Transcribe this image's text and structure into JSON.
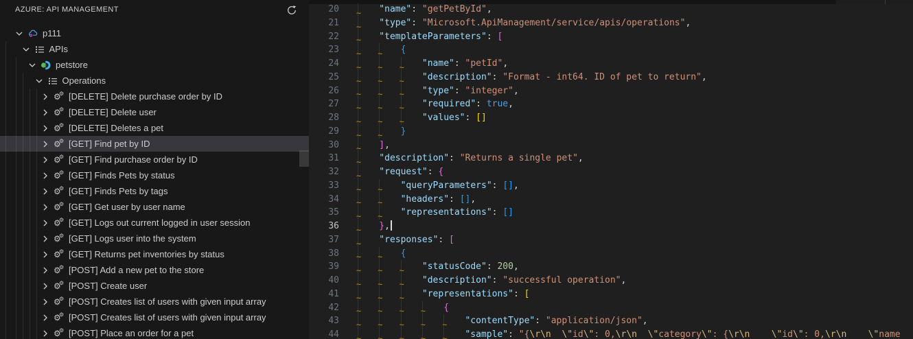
{
  "sidebar": {
    "title": "AZURE: API MANAGEMENT",
    "refresh_tooltip": "Refresh",
    "tree": [
      {
        "label": "p111",
        "level": 0,
        "icon": "azure-apim",
        "expanded": true,
        "selected": false
      },
      {
        "label": "APIs",
        "level": 1,
        "icon": "list",
        "expanded": true,
        "selected": false
      },
      {
        "label": "petstore",
        "level": 2,
        "icon": "api",
        "expanded": true,
        "selected": false
      },
      {
        "label": "Operations",
        "level": 3,
        "icon": "list",
        "expanded": true,
        "selected": false
      },
      {
        "label": "[DELETE] Delete purchase order by ID",
        "level": 4,
        "icon": "operation",
        "expanded": false,
        "selected": false
      },
      {
        "label": "[DELETE] Delete user",
        "level": 4,
        "icon": "operation",
        "expanded": false,
        "selected": false
      },
      {
        "label": "[DELETE] Deletes a pet",
        "level": 4,
        "icon": "operation",
        "expanded": false,
        "selected": false
      },
      {
        "label": "[GET] Find pet by ID",
        "level": 4,
        "icon": "operation",
        "expanded": false,
        "selected": true
      },
      {
        "label": "[GET] Find purchase order by ID",
        "level": 4,
        "icon": "operation",
        "expanded": false,
        "selected": false
      },
      {
        "label": "[GET] Finds Pets by status",
        "level": 4,
        "icon": "operation",
        "expanded": false,
        "selected": false
      },
      {
        "label": "[GET] Finds Pets by tags",
        "level": 4,
        "icon": "operation",
        "expanded": false,
        "selected": false
      },
      {
        "label": "[GET] Get user by user name",
        "level": 4,
        "icon": "operation",
        "expanded": false,
        "selected": false
      },
      {
        "label": "[GET] Logs out current logged in user session",
        "level": 4,
        "icon": "operation",
        "expanded": false,
        "selected": false
      },
      {
        "label": "[GET] Logs user into the system",
        "level": 4,
        "icon": "operation",
        "expanded": false,
        "selected": false
      },
      {
        "label": "[GET] Returns pet inventories by status",
        "level": 4,
        "icon": "operation",
        "expanded": false,
        "selected": false
      },
      {
        "label": "[POST] Add a new pet to the store",
        "level": 4,
        "icon": "operation",
        "expanded": false,
        "selected": false
      },
      {
        "label": "[POST] Create user",
        "level": 4,
        "icon": "operation",
        "expanded": false,
        "selected": false
      },
      {
        "label": "[POST] Creates list of users with given input array",
        "level": 4,
        "icon": "operation",
        "expanded": false,
        "selected": false
      },
      {
        "label": "[POST] Creates list of users with given input array",
        "level": 4,
        "icon": "operation",
        "expanded": false,
        "selected": false
      },
      {
        "label": "[POST] Place an order for a pet",
        "level": 4,
        "icon": "operation",
        "expanded": false,
        "selected": false
      }
    ]
  },
  "editor": {
    "language": "json",
    "active_line": 36,
    "first_line": 20,
    "lines": [
      {
        "n": 20,
        "tabs": 1,
        "tokens": [
          [
            "k",
            "\"name\""
          ],
          [
            "p",
            ": "
          ],
          [
            "s",
            "\"getPetById\""
          ],
          [
            "p",
            ","
          ]
        ]
      },
      {
        "n": 21,
        "tabs": 1,
        "tokens": [
          [
            "k",
            "\"type\""
          ],
          [
            "p",
            ": "
          ],
          [
            "s",
            "\"Microsoft.ApiManagement/service/apis/operations\""
          ],
          [
            "p",
            ","
          ]
        ]
      },
      {
        "n": 22,
        "tabs": 1,
        "tokens": [
          [
            "k",
            "\"templateParameters\""
          ],
          [
            "p",
            ": "
          ],
          [
            "m",
            "["
          ]
        ]
      },
      {
        "n": 23,
        "tabs": 2,
        "tokens": [
          [
            "u",
            "{"
          ]
        ]
      },
      {
        "n": 24,
        "tabs": 3,
        "tokens": [
          [
            "k",
            "\"name\""
          ],
          [
            "p",
            ": "
          ],
          [
            "s",
            "\"petId\""
          ],
          [
            "p",
            ","
          ]
        ]
      },
      {
        "n": 25,
        "tabs": 3,
        "tokens": [
          [
            "k",
            "\"description\""
          ],
          [
            "p",
            ": "
          ],
          [
            "s",
            "\"Format - int64. ID of pet to return\""
          ],
          [
            "p",
            ","
          ]
        ]
      },
      {
        "n": 26,
        "tabs": 3,
        "tokens": [
          [
            "k",
            "\"type\""
          ],
          [
            "p",
            ": "
          ],
          [
            "s",
            "\"integer\""
          ],
          [
            "p",
            ","
          ]
        ]
      },
      {
        "n": 27,
        "tabs": 3,
        "tokens": [
          [
            "k",
            "\"required\""
          ],
          [
            "p",
            ": "
          ],
          [
            "b",
            "true"
          ],
          [
            "p",
            ","
          ]
        ]
      },
      {
        "n": 28,
        "tabs": 3,
        "tokens": [
          [
            "k",
            "\"values\""
          ],
          [
            "p",
            ": "
          ],
          [
            "g",
            "[]"
          ]
        ]
      },
      {
        "n": 29,
        "tabs": 2,
        "tokens": [
          [
            "u",
            "}"
          ]
        ]
      },
      {
        "n": 30,
        "tabs": 1,
        "tokens": [
          [
            "m",
            "]"
          ],
          [
            "p",
            ","
          ]
        ]
      },
      {
        "n": 31,
        "tabs": 1,
        "tokens": [
          [
            "k",
            "\"description\""
          ],
          [
            "p",
            ": "
          ],
          [
            "s",
            "\"Returns a single pet\""
          ],
          [
            "p",
            ","
          ]
        ]
      },
      {
        "n": 32,
        "tabs": 1,
        "tokens": [
          [
            "k",
            "\"request\""
          ],
          [
            "p",
            ": "
          ],
          [
            "m",
            "{"
          ]
        ]
      },
      {
        "n": 33,
        "tabs": 2,
        "tokens": [
          [
            "k",
            "\"queryParameters\""
          ],
          [
            "p",
            ": "
          ],
          [
            "u",
            "[]"
          ],
          [
            "p",
            ","
          ]
        ]
      },
      {
        "n": 34,
        "tabs": 2,
        "tokens": [
          [
            "k",
            "\"headers\""
          ],
          [
            "p",
            ": "
          ],
          [
            "u",
            "[]"
          ],
          [
            "p",
            ","
          ]
        ]
      },
      {
        "n": 35,
        "tabs": 2,
        "tokens": [
          [
            "k",
            "\"representations\""
          ],
          [
            "p",
            ": "
          ],
          [
            "u",
            "[]"
          ]
        ]
      },
      {
        "n": 36,
        "tabs": 1,
        "tokens": [
          [
            "m",
            "}"
          ],
          [
            "p",
            ","
          ],
          [
            "cur",
            ""
          ]
        ]
      },
      {
        "n": 37,
        "tabs": 1,
        "tokens": [
          [
            "k",
            "\"responses\""
          ],
          [
            "p",
            ": "
          ],
          [
            "m",
            "["
          ]
        ]
      },
      {
        "n": 38,
        "tabs": 2,
        "tokens": [
          [
            "u",
            "{"
          ]
        ]
      },
      {
        "n": 39,
        "tabs": 3,
        "tokens": [
          [
            "k",
            "\"statusCode\""
          ],
          [
            "p",
            ": "
          ],
          [
            "n",
            "200"
          ],
          [
            "p",
            ","
          ]
        ]
      },
      {
        "n": 40,
        "tabs": 3,
        "tokens": [
          [
            "k",
            "\"description\""
          ],
          [
            "p",
            ": "
          ],
          [
            "s",
            "\"successful operation\""
          ],
          [
            "p",
            ","
          ]
        ]
      },
      {
        "n": 41,
        "tabs": 3,
        "tokens": [
          [
            "k",
            "\"representations\""
          ],
          [
            "p",
            ": "
          ],
          [
            "g",
            "["
          ]
        ]
      },
      {
        "n": 42,
        "tabs": 4,
        "tokens": [
          [
            "m",
            "{"
          ]
        ]
      },
      {
        "n": 43,
        "tabs": 5,
        "tokens": [
          [
            "k",
            "\"contentType\""
          ],
          [
            "p",
            ": "
          ],
          [
            "s",
            "\"application/json\""
          ],
          [
            "p",
            ","
          ]
        ]
      },
      {
        "n": 44,
        "tabs": 5,
        "tokens": [
          [
            "k",
            "\"sample\""
          ],
          [
            "p",
            ": "
          ],
          [
            "s",
            "\"{"
          ],
          [
            "e",
            "\\r\\n"
          ],
          [
            "s",
            "  "
          ],
          [
            "e",
            "\\\""
          ],
          [
            "s",
            "id"
          ],
          [
            "e",
            "\\\""
          ],
          [
            "s",
            ": 0,"
          ],
          [
            "e",
            "\\r\\n"
          ],
          [
            "s",
            "  "
          ],
          [
            "e",
            "\\\""
          ],
          [
            "s",
            "category"
          ],
          [
            "e",
            "\\\""
          ],
          [
            "s",
            ": {"
          ],
          [
            "e",
            "\\r\\n"
          ],
          [
            "s",
            "    "
          ],
          [
            "e",
            "\\\""
          ],
          [
            "s",
            "id"
          ],
          [
            "e",
            "\\\""
          ],
          [
            "s",
            ": 0,"
          ],
          [
            "e",
            "\\r\\n"
          ],
          [
            "s",
            "    "
          ],
          [
            "e",
            "\\\""
          ],
          [
            "s",
            "name"
          ]
        ]
      }
    ]
  },
  "colors": {
    "sidebar_bg": "#181818",
    "editor_bg": "#1f1f1f",
    "selection_bg": "#37373d",
    "key": "#9cdcfe",
    "string": "#ce9178",
    "escape": "#d7ba7d",
    "number": "#b5cea8",
    "boolean": "#569cd6",
    "punctuation": "#d4d4d4",
    "bracket_gold": "#ffd700",
    "bracket_pink": "#da70d6",
    "bracket_blue": "#179fff",
    "tab_whitespace_mark": "#b8860b",
    "line_number": "#6e7681",
    "line_number_active": "#c6c6c6",
    "api_icon_green": "#5bb75b",
    "api_icon_blue": "#45b0e6",
    "apim_cloud_blue": "#4f9cd6",
    "apim_dot_magenta": "#b14fc8"
  }
}
